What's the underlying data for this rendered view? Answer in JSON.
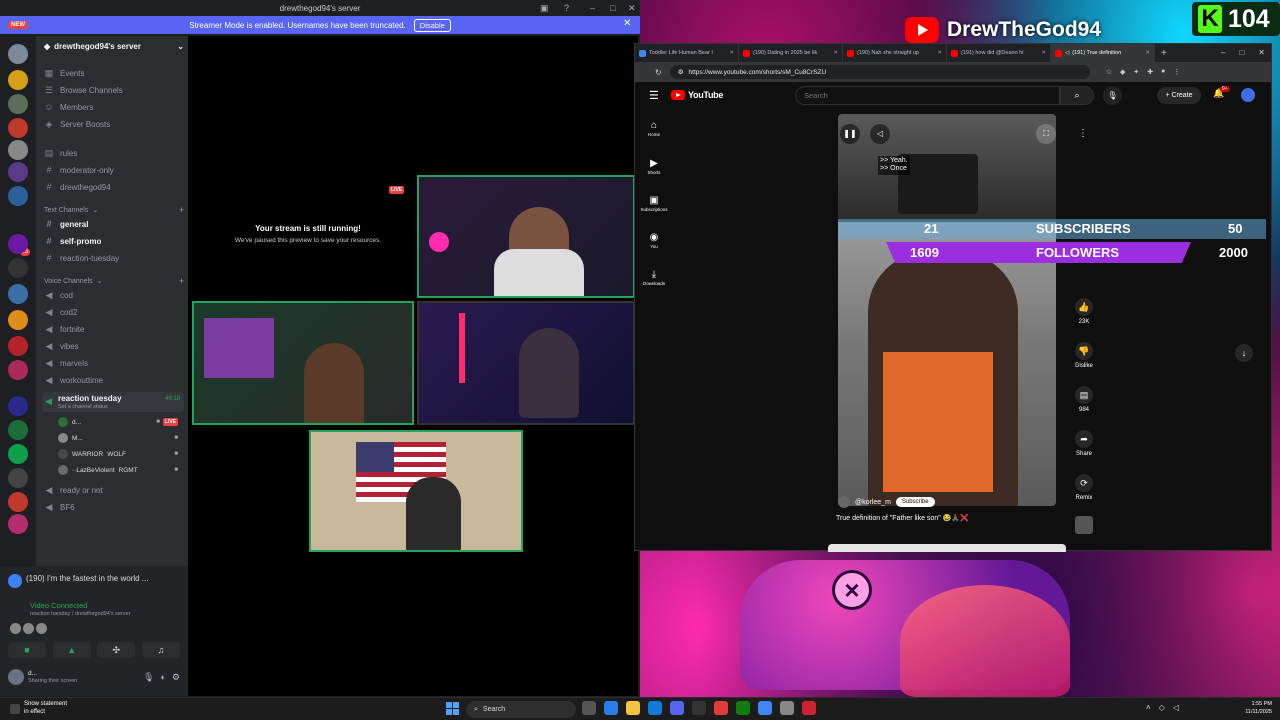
{
  "overlay": {
    "youtube_channel": "DrewTheGod94",
    "kick_count": "104",
    "subscribers_current": "21",
    "subscribers_label": "SUBSCRIBERS",
    "subscribers_goal": "50",
    "followers_current": "1609",
    "followers_label": "FOLLOWERS",
    "followers_goal": "2000",
    "colors": {
      "followers_bar": "#9b2fe0",
      "subscribers_bar": "#64aadc"
    }
  },
  "discord": {
    "window_title": "drewthegod94's server",
    "new_badge": "NEW",
    "streamer_mode_text": "Streamer Mode is enabled. Usernames have been truncated.",
    "disable_label": "Disable",
    "server_name": "drewthegod94's server",
    "top_items": [
      {
        "icon": "calendar-icon",
        "label": "Events"
      },
      {
        "icon": "browse-icon",
        "label": "Browse Channels"
      },
      {
        "icon": "members-icon",
        "label": "Members"
      },
      {
        "icon": "boost-icon",
        "label": "Server Boosts"
      }
    ],
    "info_channels": [
      "rules",
      "moderator-only",
      "drewthegod94"
    ],
    "text_category": "Text Channels",
    "text_channels": [
      {
        "label": "general",
        "bold": true
      },
      {
        "label": "self-promo",
        "bold": true
      },
      {
        "label": "reaction-tuesday",
        "bold": false
      }
    ],
    "voice_category": "Voice Channels",
    "voice_channels": [
      "cod",
      "cod2",
      "fortnite",
      "vibes",
      "marvels",
      "workouttime"
    ],
    "active_voice": {
      "name": "reaction tuesday",
      "status": "Set a channel status",
      "time": "49:18"
    },
    "voice_users": [
      {
        "name": "d...",
        "live": "LIVE"
      },
      {
        "name": "M...",
        "live": ""
      },
      {
        "name": "WARRIOR",
        "tag": "WOLF"
      },
      {
        "name": "··LazBeViolent",
        "tag": "RGMT"
      }
    ],
    "extra_voice": [
      "ready or not",
      "BF6"
    ],
    "now_playing": "(190) I'm the fastest in the world ...",
    "video_connected": "Video Connected",
    "connected_sub": "reaction tuesday / drewthegod94's server",
    "user_name": "d...",
    "user_status": "Sharing their screen",
    "stage": {
      "paused_title": "Your stream is still running!",
      "paused_sub": "We've paused this preview to save your resources.",
      "live_label": "LIVE"
    }
  },
  "browser": {
    "tabs": [
      {
        "label": "Toddler Life Human Bear I",
        "active": false
      },
      {
        "label": "(190) Dating in 2025 be lik",
        "active": false
      },
      {
        "label": "(190) Nah she straight up",
        "active": false
      },
      {
        "label": "(191) how did @Deano hi",
        "active": false
      },
      {
        "label": "(191) True definition",
        "active": true
      }
    ],
    "url": "https://www.youtube.com/shorts/sM_Cu8CrSZU",
    "yt": {
      "brand": "YouTube",
      "search_placeholder": "Search",
      "create_label": "Create",
      "notif_badge": "9+",
      "sidebar": [
        {
          "icon": "home-icon",
          "label": "Home"
        },
        {
          "icon": "shorts-icon",
          "label": "Shorts"
        },
        {
          "icon": "subscriptions-icon",
          "label": "Subscriptions"
        },
        {
          "icon": "you-icon",
          "label": "You"
        },
        {
          "icon": "downloads-icon",
          "label": "Downloads"
        }
      ],
      "video_caption": ">> Yeah.\n>> Once",
      "channel": "@korlee_m",
      "subscribe_label": "Subscribe",
      "title": "True definition of \"Father like son\" 😂🙏🏾❌",
      "actions": [
        {
          "icon": "like-icon",
          "label": "23K"
        },
        {
          "icon": "dislike-icon",
          "label": "Dislike"
        },
        {
          "icon": "comment-icon",
          "label": "984"
        },
        {
          "icon": "share-icon",
          "label": "Share"
        },
        {
          "icon": "remix-icon",
          "label": "Remix"
        }
      ]
    }
  },
  "taskbar": {
    "news_title": "Snow statement",
    "news_sub": "in effect",
    "search_label": "Search",
    "time": "1:55 PM",
    "date": "11/11/2025"
  }
}
